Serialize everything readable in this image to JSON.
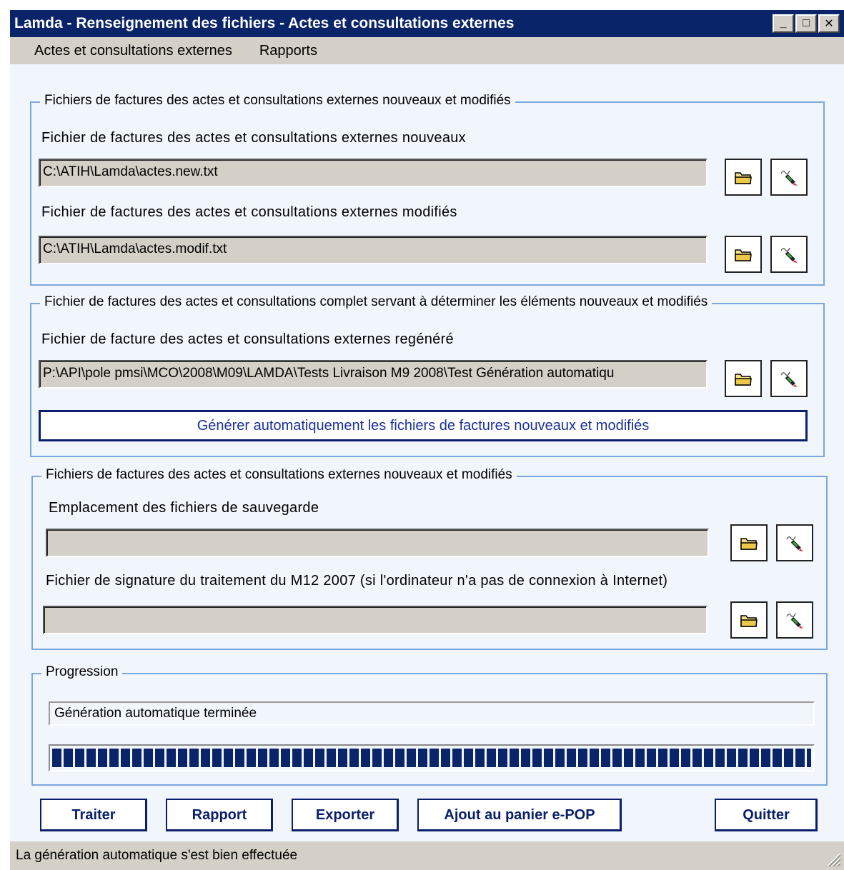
{
  "window": {
    "title": "Lamda - Renseignement des fichiers - Actes et consultations externes"
  },
  "titlebar_buttons": {
    "minimize": "_",
    "maximize": "□",
    "close": "✕"
  },
  "menu": {
    "items": [
      "Actes et consultations externes",
      "Rapports"
    ]
  },
  "group1": {
    "legend": "Fichiers de factures des actes et consultations externes nouveaux et modifiés",
    "field1_label": "Fichier de factures des actes et consultations externes nouveaux",
    "field1_value": "C:\\ATIH\\Lamda\\actes.new.txt",
    "field2_label": "Fichier de factures des actes et consultations externes modifiés",
    "field2_value": "C:\\ATIH\\Lamda\\actes.modif.txt"
  },
  "group2": {
    "legend": "Fichier de factures des actes et consultations complet servant à déterminer les éléments nouveaux et modifiés",
    "field_label": "Fichier de facture des actes et consultations externes regénéré",
    "field_value": "P:\\API\\pole pmsi\\MCO\\2008\\M09\\LAMDA\\Tests Livraison M9 2008\\Test Génération automatiqu",
    "generate_button": "Générer automatiquement les fichiers de factures nouveaux et modifiés"
  },
  "group3": {
    "legend": "Fichiers de factures des actes et consultations externes  nouveaux et modifiés",
    "field1_label": "Emplacement des fichiers de sauvegarde",
    "field1_value": "",
    "field2_label": "Fichier de signature du traitement du M12 2007 (si l'ordinateur n'a pas de connexion à Internet)",
    "field2_value": ""
  },
  "progress": {
    "legend": "Progression",
    "status_text": "Génération automatique terminée",
    "fraction": 1.0
  },
  "buttons": {
    "traiter": "Traiter",
    "rapport": "Rapport",
    "exporter": "Exporter",
    "panier": "Ajout au panier e-POP",
    "quitter": "Quitter"
  },
  "statusbar": {
    "text": "La génération automatique s'est bien effectuée"
  },
  "icons": {
    "browse": "folder-icon",
    "edit": "edit-pen-icon"
  },
  "colors": {
    "title_bg": "#0a246a",
    "client_bg": "#f1f6fd",
    "group_border": "#7aa7dd",
    "progress": "#0a246a"
  }
}
